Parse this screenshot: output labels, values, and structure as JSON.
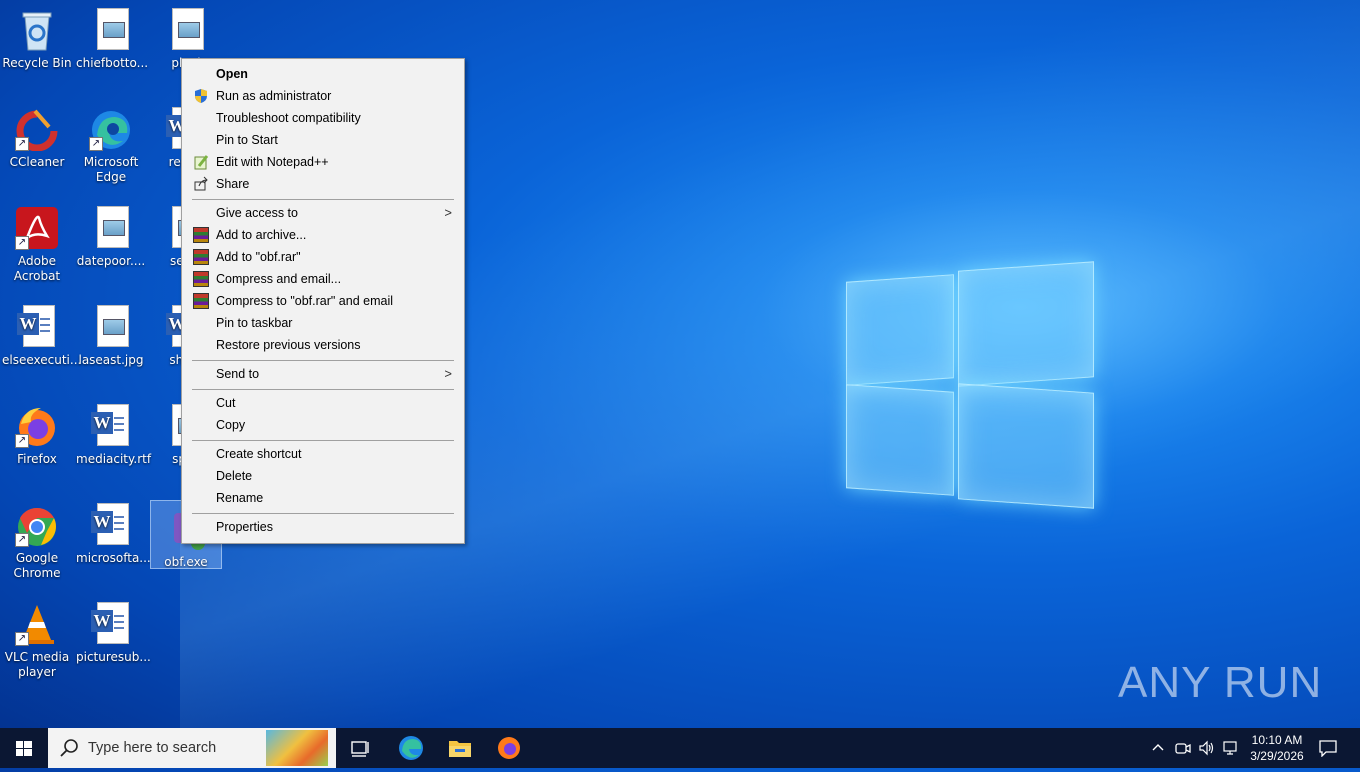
{
  "desktop": {
    "icons": [
      {
        "label": "Recycle Bin",
        "icon": "recycle-bin-icon"
      },
      {
        "label": "chiefbotto...",
        "icon": "image-file-icon"
      },
      {
        "label": "plani",
        "icon": "image-file-icon"
      },
      {
        "label": "CCleaner",
        "icon": "ccleaner-icon"
      },
      {
        "label": "Microsoft Edge",
        "icon": "edge-icon"
      },
      {
        "label": "reque",
        "icon": "word-doc-icon"
      },
      {
        "label": "Adobe Acrobat",
        "icon": "acrobat-icon"
      },
      {
        "label": "datepoor....",
        "icon": "image-file-icon"
      },
      {
        "label": "senio",
        "icon": "image-file-icon"
      },
      {
        "label": "elseexecuti...",
        "icon": "word-doc-icon"
      },
      {
        "label": "laseast.jpg",
        "icon": "image-file-icon"
      },
      {
        "label": "sheet",
        "icon": "word-doc-icon"
      },
      {
        "label": "Firefox",
        "icon": "firefox-icon"
      },
      {
        "label": "mediacity.rtf",
        "icon": "word-doc-icon"
      },
      {
        "label": "spec",
        "icon": "image-file-icon"
      },
      {
        "label": "Google Chrome",
        "icon": "chrome-icon"
      },
      {
        "label": "microsofta...",
        "icon": "word-doc-icon"
      },
      {
        "label": "obf.exe",
        "icon": "exe-icon"
      },
      {
        "label": "VLC media player",
        "icon": "vlc-icon"
      },
      {
        "label": "picturesub...",
        "icon": "word-doc-icon"
      }
    ]
  },
  "context_menu": {
    "items": [
      {
        "label": "Open"
      },
      {
        "label": "Run as administrator"
      },
      {
        "label": "Troubleshoot compatibility"
      },
      {
        "label": "Pin to Start"
      },
      {
        "label": "Edit with Notepad++"
      },
      {
        "label": "Share"
      },
      {
        "label": "Give access to"
      },
      {
        "label": "Add to archive..."
      },
      {
        "label": "Add to \"obf.rar\""
      },
      {
        "label": "Compress and email..."
      },
      {
        "label": "Compress to \"obf.rar\" and email"
      },
      {
        "label": "Pin to taskbar"
      },
      {
        "label": "Restore previous versions"
      },
      {
        "label": "Send to"
      },
      {
        "label": "Cut"
      },
      {
        "label": "Copy"
      },
      {
        "label": "Create shortcut"
      },
      {
        "label": "Delete"
      },
      {
        "label": "Rename"
      },
      {
        "label": "Properties"
      }
    ]
  },
  "taskbar": {
    "search_placeholder": "Type here to search",
    "time": "10:10 AM",
    "date": "3/29/2026"
  },
  "watermark": "ANY RUN",
  "colors": {
    "accent": "#0a64d8",
    "taskbar": "#0b1733",
    "menu_bg": "#f2f2f2"
  }
}
